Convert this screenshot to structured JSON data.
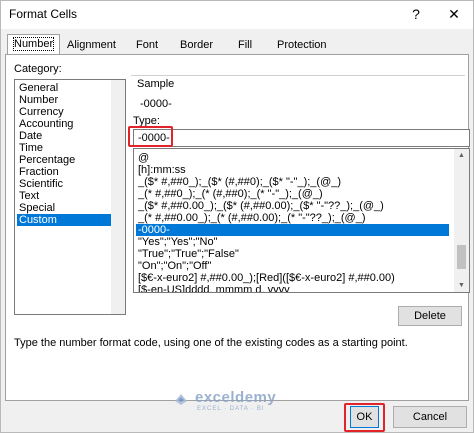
{
  "window": {
    "title": "Format Cells",
    "help_glyph": "?",
    "close_glyph": "✕"
  },
  "tabs": [
    "Number",
    "Alignment",
    "Font",
    "Border",
    "Fill",
    "Protection"
  ],
  "category": {
    "label": "Category:",
    "items": [
      "General",
      "Number",
      "Currency",
      "Accounting",
      "Date",
      "Time",
      "Percentage",
      "Fraction",
      "Scientific",
      "Text",
      "Special",
      "Custom"
    ],
    "selected": "Custom"
  },
  "sample": {
    "label": "Sample",
    "value": "-0000-"
  },
  "type": {
    "label": "Type:",
    "value": "-0000-"
  },
  "formats": [
    "@",
    "[h]:mm:ss",
    "_($* #,##0_);_($* (#,##0);_($* \"-\"_);_(@_)",
    "_(* #,##0_);_(* (#,##0);_(* \"-\"_);_(@_)",
    "_($* #,##0.00_);_($* (#,##0.00);_($* \"-\"??_);_(@_)",
    "_(* #,##0.00_);_(* (#,##0.00);_(* \"-\"??_);_(@_)",
    "-0000-",
    "\"Yes\";\"Yes\";\"No\"",
    "\"True\";\"True\";\"False\"",
    "\"On\";\"On\";\"Off\"",
    "[$€-x-euro2] #,##0.00_);[Red]([$€-x-euro2] #,##0.00)",
    "[$-en-US]dddd, mmmm d, yyyy"
  ],
  "formats_selected": "-0000-",
  "delete_label": "Delete",
  "help_text": "Type the number format code, using one of the existing codes as a starting point.",
  "ok_label": "OK",
  "cancel_label": "Cancel",
  "watermark": {
    "name": "exceldemy",
    "tagline": "EXCEL · DATA · BI"
  },
  "colors": {
    "selection": "#0078d7",
    "highlight": "#e0242a"
  }
}
